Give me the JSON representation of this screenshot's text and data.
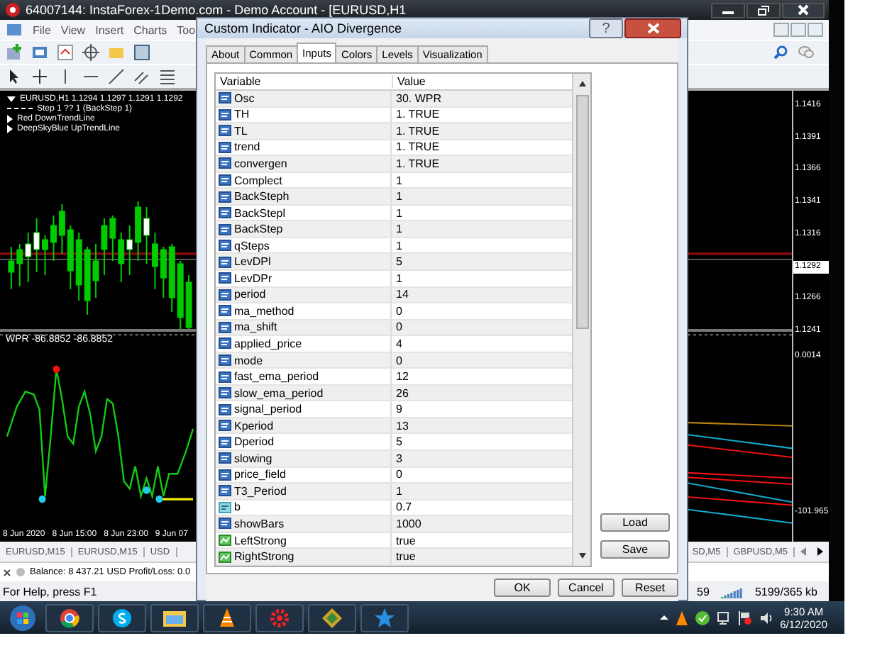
{
  "mt4_window": {
    "title": "64007144: InstaForex-1Demo.com - Demo Account - [EURUSD,H1",
    "menu": [
      "File",
      "View",
      "Insert",
      "Charts",
      "Too"
    ],
    "legend": [
      {
        "kind": "symbol",
        "text": "EURUSD,H1  1.1294 1.1297 1.1291 1.1292"
      },
      {
        "kind": "line",
        "text": "Step 1 ?? 1 (BackStep 1)"
      },
      {
        "kind": "object",
        "text": "Red DownTrendLine"
      },
      {
        "kind": "object",
        "text": "DeepSkyBlue UpTrendLine"
      }
    ],
    "price_labels": [
      {
        "text": "1.1416",
        "current": false
      },
      {
        "text": "1.1391",
        "current": false
      },
      {
        "text": "1.1366",
        "current": false
      },
      {
        "text": "1.1341",
        "current": false
      },
      {
        "text": "1.1316",
        "current": false
      },
      {
        "text": "1.1292",
        "current": true
      },
      {
        "text": "1.1266",
        "current": false
      },
      {
        "text": "1.1241",
        "current": false
      }
    ],
    "indicator_label": "WPR -86.8852 -86.8852",
    "indicator_scale": [
      "0.0014",
      "-101.965"
    ],
    "time_labels": [
      "8 Jun 2020",
      "8 Jun 15:00",
      "8 Jun 23:00",
      "9 Jun 07"
    ],
    "chart_tabs_left": [
      "EURUSD,M15",
      "EURUSD,M15",
      "USD"
    ],
    "chart_tabs_right": [
      "SD,M5",
      "GBPUSD,M5"
    ],
    "terminal_text": "Balance: 8 437.21 USD  Profit/Loss: 0.0",
    "status": {
      "help": "For Help, press F1",
      "bars": "59",
      "traffic": "5199/365 kb"
    }
  },
  "dialog": {
    "title": "Custom Indicator - AIO Divergence",
    "help": "?",
    "tabs": [
      {
        "label": "About",
        "selected": false
      },
      {
        "label": "Common",
        "selected": false
      },
      {
        "label": "Inputs",
        "selected": true
      },
      {
        "label": "Colors",
        "selected": false
      },
      {
        "label": "Levels",
        "selected": false
      },
      {
        "label": "Visualization",
        "selected": false
      }
    ],
    "columns": [
      "Variable",
      "Value"
    ],
    "rows": [
      {
        "kind": "int",
        "variable": "Osc",
        "value": "30. WPR"
      },
      {
        "kind": "int",
        "variable": "TH",
        "value": "1. TRUE"
      },
      {
        "kind": "int",
        "variable": "TL",
        "value": "1. TRUE"
      },
      {
        "kind": "int",
        "variable": "trend",
        "value": "1. TRUE"
      },
      {
        "kind": "int",
        "variable": "convergen",
        "value": "1. TRUE"
      },
      {
        "kind": "int",
        "variable": "Complect",
        "value": "1"
      },
      {
        "kind": "int",
        "variable": "BackSteph",
        "value": "1"
      },
      {
        "kind": "int",
        "variable": "BackStepl",
        "value": "1"
      },
      {
        "kind": "int",
        "variable": "BackStep",
        "value": "1"
      },
      {
        "kind": "int",
        "variable": "qSteps",
        "value": "1"
      },
      {
        "kind": "int",
        "variable": "LevDPl",
        "value": "5"
      },
      {
        "kind": "int",
        "variable": "LevDPr",
        "value": "1"
      },
      {
        "kind": "int",
        "variable": "period",
        "value": "14"
      },
      {
        "kind": "int",
        "variable": "ma_method",
        "value": "0"
      },
      {
        "kind": "int",
        "variable": "ma_shift",
        "value": "0"
      },
      {
        "kind": "int",
        "variable": "applied_price",
        "value": "4"
      },
      {
        "kind": "int",
        "variable": "mode",
        "value": "0"
      },
      {
        "kind": "int",
        "variable": "fast_ema_period",
        "value": "12"
      },
      {
        "kind": "int",
        "variable": "slow_ema_period",
        "value": "26"
      },
      {
        "kind": "int",
        "variable": "signal_period",
        "value": "9"
      },
      {
        "kind": "int",
        "variable": "Kperiod",
        "value": "13"
      },
      {
        "kind": "int",
        "variable": "Dperiod",
        "value": "5"
      },
      {
        "kind": "int",
        "variable": "slowing",
        "value": "3"
      },
      {
        "kind": "int",
        "variable": "price_field",
        "value": "0"
      },
      {
        "kind": "int",
        "variable": "T3_Period",
        "value": "1"
      },
      {
        "kind": "double",
        "variable": "b",
        "value": "0.7"
      },
      {
        "kind": "int",
        "variable": "showBars",
        "value": "1000"
      },
      {
        "kind": "bool",
        "variable": "LeftStrong",
        "value": "true"
      },
      {
        "kind": "bool",
        "variable": "RightStrong",
        "value": "true"
      }
    ],
    "side_buttons": [
      "Load",
      "Save"
    ],
    "buttons": [
      "OK",
      "Cancel",
      "Reset"
    ]
  },
  "taskbar": {
    "time": "9:30 AM",
    "date": "6/12/2020"
  }
}
